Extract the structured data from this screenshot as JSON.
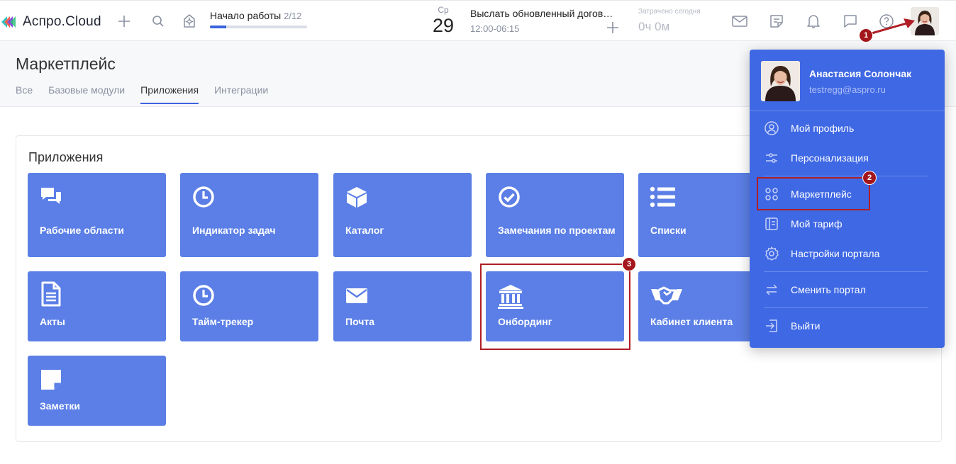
{
  "header": {
    "logo_text": "Аспро.Cloud",
    "onboarding": {
      "title": "Начало работы",
      "count": "2/12",
      "progress": 0.17
    },
    "date": {
      "weekday": "Ср",
      "day": "29"
    },
    "task": {
      "title": "Выслать обновленный догов…",
      "time": "12:00-06:15"
    },
    "spent": {
      "label": "Затрачено сегодня",
      "value": "0ч 0м"
    }
  },
  "page": {
    "title": "Маркетплейс",
    "tabs": [
      {
        "label": "Все"
      },
      {
        "label": "Базовые модули"
      },
      {
        "label": "Приложения",
        "active": true
      },
      {
        "label": "Интеграции"
      }
    ]
  },
  "panel": {
    "title": "Приложения",
    "tiles": [
      {
        "label": "Рабочие области",
        "icon": "chat-bubbles-icon"
      },
      {
        "label": "Индикатор задач",
        "icon": "clock-icon"
      },
      {
        "label": "Каталог",
        "icon": "cube-icon"
      },
      {
        "label": "Замечания по проектам",
        "icon": "check-circle-icon"
      },
      {
        "label": "Списки",
        "icon": "list-icon"
      },
      {
        "label": "Акты",
        "icon": "document-icon"
      },
      {
        "label": "Тайм-трекер",
        "icon": "clock-icon"
      },
      {
        "label": "Почта",
        "icon": "envelope-icon"
      },
      {
        "label": "Онбординг",
        "icon": "bank-icon"
      },
      {
        "label": "Кабинет клиента",
        "icon": "handshake-icon"
      },
      {
        "label": "Заметки",
        "icon": "note-icon"
      }
    ]
  },
  "dropdown": {
    "user_name": "Анастасия Солончак",
    "user_email": "testregg@aspro.ru",
    "items": [
      {
        "label": "Мой профиль",
        "icon": "user-circle-icon"
      },
      {
        "label": "Персонализация",
        "icon": "sliders-icon"
      },
      {
        "label": "Маркетплейс",
        "icon": "grid-dots-icon"
      },
      {
        "label": "Мой тариф",
        "icon": "tariff-icon"
      },
      {
        "label": "Настройки портала",
        "icon": "gear-icon"
      },
      {
        "label": "Сменить портал",
        "icon": "swap-icon"
      },
      {
        "label": "Выйти",
        "icon": "logout-icon"
      }
    ]
  },
  "annotations": {
    "badge_1": "1",
    "badge_2": "2",
    "badge_3": "3"
  },
  "colors": {
    "accent": "#3c63dd",
    "tile": "#5b7fe6",
    "dropdown": "#3f68e4",
    "annotation": "#b01f25"
  }
}
